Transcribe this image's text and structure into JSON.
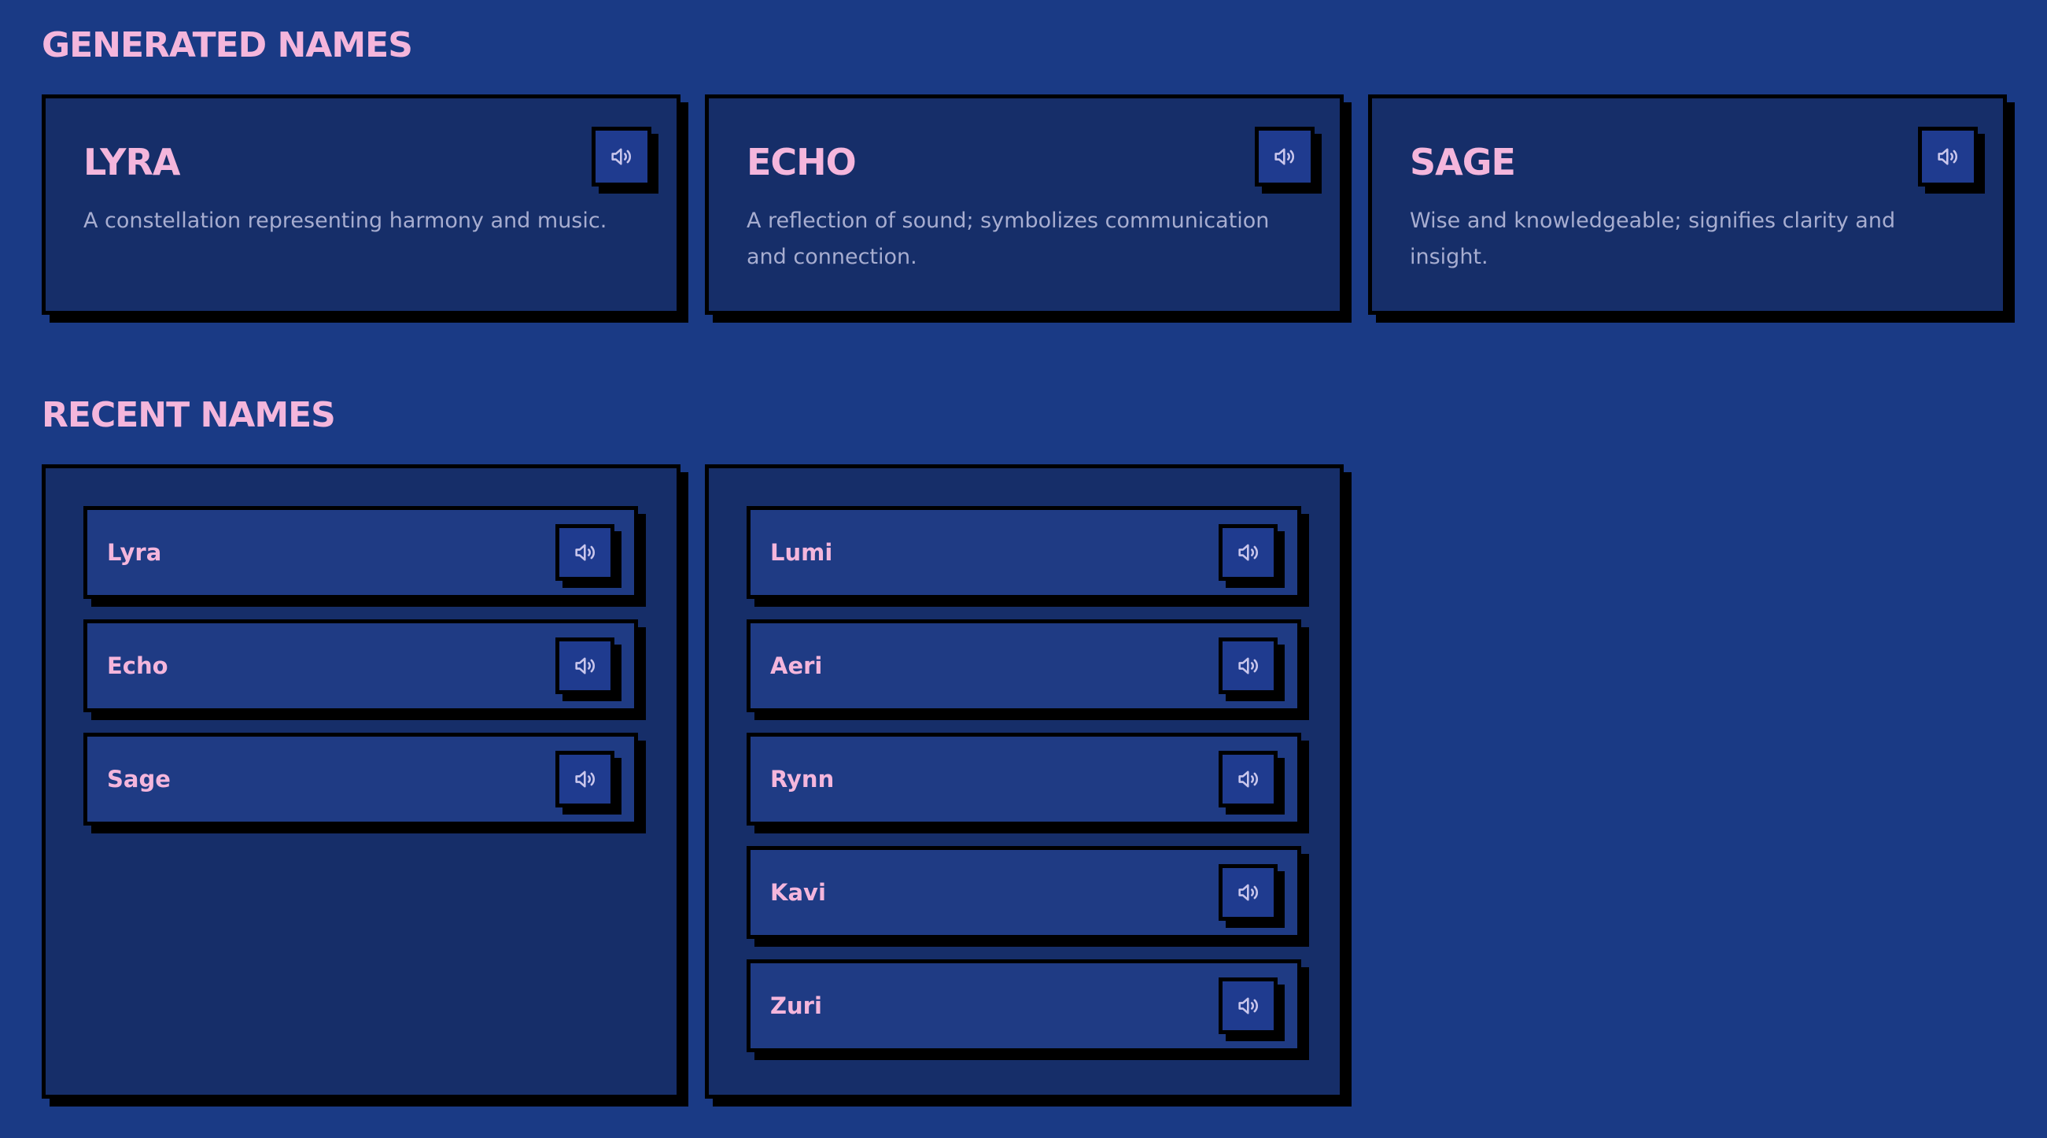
{
  "generated": {
    "title": "GENERATED NAMES",
    "cards": [
      {
        "name": "LYRA",
        "description": "A constellation representing harmony and music."
      },
      {
        "name": "ECHO",
        "description": "A reflection of sound; symbolizes communication and connection."
      },
      {
        "name": "SAGE",
        "description": "Wise and knowledgeable; signifies clarity and insight."
      }
    ]
  },
  "recent": {
    "title": "RECENT NAMES",
    "columns": [
      [
        "Lyra",
        "Echo",
        "Sage"
      ],
      [
        "Lumi",
        "Aeri",
        "Rynn",
        "Kavi",
        "Zuri"
      ]
    ]
  },
  "icons": {
    "speak": "speaker-icon"
  },
  "colors": {
    "background": "#1a3a85",
    "card": "#162e69",
    "item": "#1f3b84",
    "accent_text": "#f4b6dc",
    "muted_text": "#a7add0",
    "border": "#000000"
  }
}
